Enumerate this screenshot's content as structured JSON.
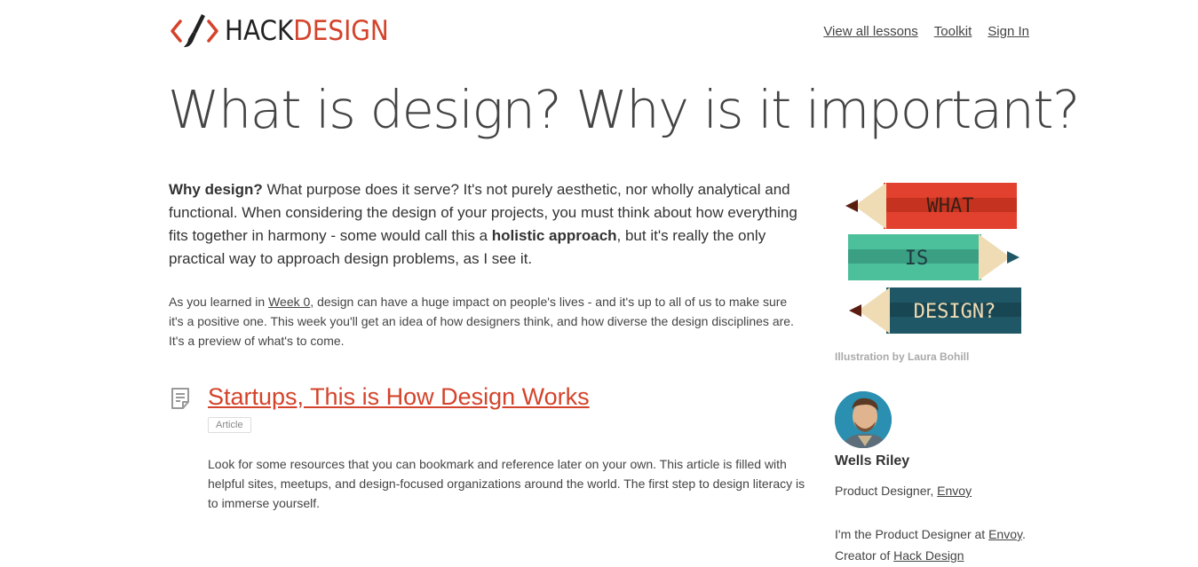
{
  "brand": {
    "hack": "HACK",
    "design": "DESIGN"
  },
  "nav": [
    {
      "label": "View all lessons"
    },
    {
      "label": "Toolkit"
    },
    {
      "label": "Sign In"
    }
  ],
  "page_title": "What is design? Why is it important?",
  "lead": {
    "strong1": "Why design?",
    "text1": " What purpose does it serve? It's not purely aesthetic, nor wholly analytical and functional. When considering the design of your projects, you must think about how everything fits together in harmony - some would call this a ",
    "strong2": "holistic approach",
    "text2": ", but it's really the only practical way to approach design problems, as I see it."
  },
  "intro": {
    "pre": "As you learned in ",
    "link": "Week 0",
    "post": ", design can have a huge impact on people's lives - and it's up to all of us to make sure it's a positive one. This week you'll get an idea of how designers think, and how diverse the design disciplines are. It's a preview of what's to come."
  },
  "lesson": {
    "title": "Startups, This is How Design Works",
    "badge": "Article",
    "description": "Look for some resources that you can bookmark and reference later on your own. This article is filled with helpful sites, meetups, and design-focused organizations around the world. The first step to design literacy is to immerse yourself."
  },
  "illustration": {
    "words": [
      "WHAT",
      "IS",
      "DESIGN?"
    ],
    "caption": "Illustration by Laura Bohill",
    "colors": {
      "red": "#e2412f",
      "teal": "#4cc09b",
      "navy": "#1f5766",
      "wood": "#f0dcb4",
      "tip": "#5a1e10"
    }
  },
  "author": {
    "name": "Wells Riley",
    "role_pre": "Product Designer, ",
    "role_link": "Envoy",
    "bio_pre": "I'm the Product Designer at ",
    "bio_link1": "Envoy",
    "bio_mid": ". Creator of ",
    "bio_link2": "Hack Design"
  },
  "colors": {
    "accent": "#d4432b",
    "text": "#333333",
    "muted": "#aaaaaa"
  }
}
